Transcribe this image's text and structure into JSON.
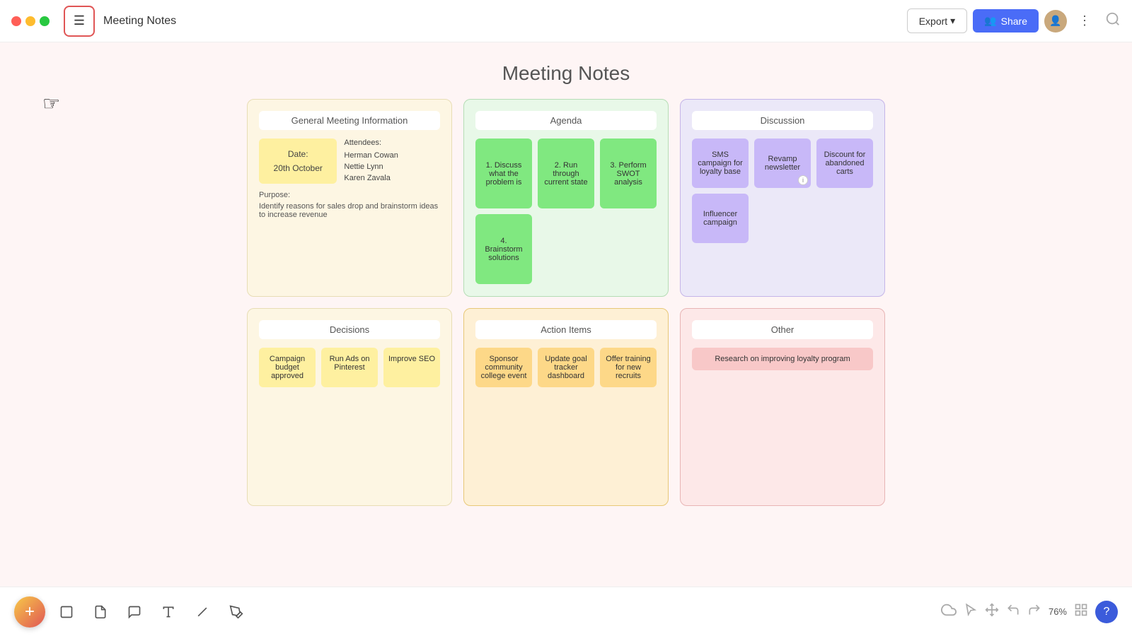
{
  "titlebar": {
    "doc_title": "Meeting Notes",
    "export_label": "Export",
    "share_label": "Share",
    "more_label": "⋮"
  },
  "canvas": {
    "title": "Meeting Notes"
  },
  "boards": {
    "general": {
      "title": "General Meeting Information",
      "date_label": "Date:",
      "date_value": "20th October",
      "attendees_label": "Attendees:",
      "attendees": [
        "Herman Cowan",
        "Nettie Lynn",
        "Karen Zavala"
      ],
      "purpose_label": "Purpose:",
      "purpose_text": "Identify reasons for sales drop and brainstorm ideas to increase revenue"
    },
    "agenda": {
      "title": "Agenda",
      "items": [
        "1. Discuss what the problem is",
        "2. Run through current state",
        "3. Perform SWOT analysis",
        "4. Brainstorm solutions"
      ]
    },
    "discussion": {
      "title": "Discussion",
      "items": [
        "SMS campaign for loyalty base",
        "Revamp newsletter",
        "Discount for abandoned carts",
        "Influencer campaign"
      ],
      "info_item_index": 1
    },
    "decisions": {
      "title": "Decisions",
      "items": [
        "Campaign budget approved",
        "Run Ads on Pinterest",
        "Improve SEO"
      ]
    },
    "actions": {
      "title": "Action Items",
      "items": [
        "Sponsor community college event",
        "Update goal tracker dashboard",
        "Offer training for new recruits"
      ]
    },
    "other": {
      "title": "Other",
      "items": [
        "Research on improving loyalty program"
      ]
    }
  },
  "toolbar": {
    "zoom": "76%",
    "tools": [
      "rectangle",
      "sticky-note",
      "speech-bubble",
      "text",
      "line",
      "highlight"
    ]
  }
}
